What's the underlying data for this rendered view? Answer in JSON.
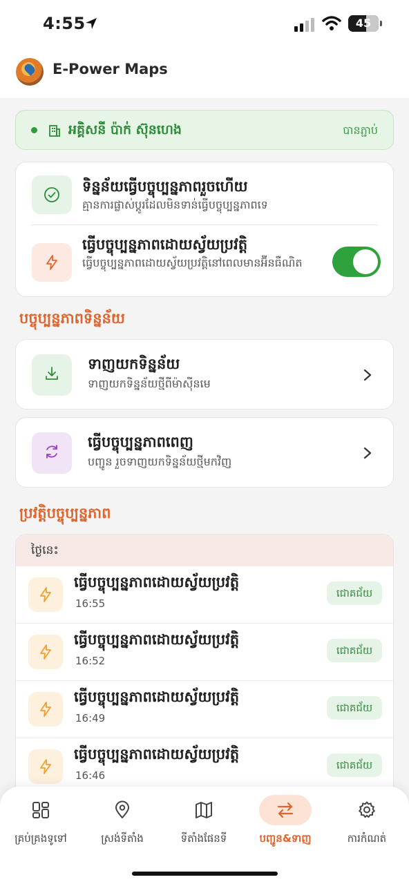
{
  "status_bar": {
    "time": "4:55",
    "battery": "45"
  },
  "app": {
    "title": "E-Power Maps"
  },
  "connection": {
    "name": "អគ្គិសនី ប៉ាក់ ស៊ុនហេង",
    "status": "បានភ្ជាប់"
  },
  "sync_status": {
    "title": "ទិន្នន័យធ្វើបច្ចុប្បន្នភាពរួចហើយ",
    "subtitle": "គ្មានការផ្លាស់ប្តូរដែលមិនទាន់ធ្វើបច្ចុប្បន្នភាពទេ",
    "auto_title": "ធ្វើបច្ចុប្បន្នភាពដោយស្វ័យប្រវត្តិ",
    "auto_subtitle": "ធ្វើបច្ចុប្បន្នភាពដោយស្វ័យប្រវត្តិនៅពេលមានអ៊ីនធឺណិត",
    "auto_enabled": true
  },
  "update_section": {
    "title": "បច្ចុប្បន្នភាពទិន្នន័យ",
    "download": {
      "title": "ទាញយកទិន្នន័យ",
      "subtitle": "ទាញយកទិន្នន័យថ្មីពីម៉ាស៊ីនមេ"
    },
    "full_sync": {
      "title": "ធ្វើបច្ចុប្បន្នភាពពេញ",
      "subtitle": "បញ្ជូន រួចទាញយកទិន្នន័យថ្មីមកវិញ"
    }
  },
  "history": {
    "title": "ប្រវត្តិបច្ចុប្បន្នភាព",
    "group": "ថ្ងៃនេះ",
    "items": [
      {
        "title": "ធ្វើបច្ចុប្បន្នភាពដោយស្វ័យប្រវត្តិ",
        "time": "16:55",
        "status": "ជោគជ័យ"
      },
      {
        "title": "ធ្វើបច្ចុប្បន្នភាពដោយស្វ័យប្រវត្តិ",
        "time": "16:52",
        "status": "ជោគជ័យ"
      },
      {
        "title": "ធ្វើបច្ចុប្បន្នភាពដោយស្វ័យប្រវត្តិ",
        "time": "16:49",
        "status": "ជោគជ័យ"
      },
      {
        "title": "ធ្វើបច្ចុប្បន្នភាពដោយស្វ័យប្រវត្តិ",
        "time": "16:46",
        "status": "ជោគជ័យ"
      }
    ]
  },
  "nav": {
    "items": [
      {
        "label": "គ្រប់គ្រងទូទៅ",
        "icon": "dashboard-icon"
      },
      {
        "label": "ស្រង់ទីតាំង",
        "icon": "location-pin-icon"
      },
      {
        "label": "ទីតាំងផែនទី",
        "icon": "map-icon"
      },
      {
        "label": "បញ្ជូន&ទាញ",
        "icon": "sync-arrows-icon",
        "active": true
      },
      {
        "label": "ការកំណត់",
        "icon": "gear-icon"
      }
    ]
  },
  "colors": {
    "accent": "#e0642e",
    "success": "#2fa23d",
    "success_bg": "#e6f4e7"
  }
}
